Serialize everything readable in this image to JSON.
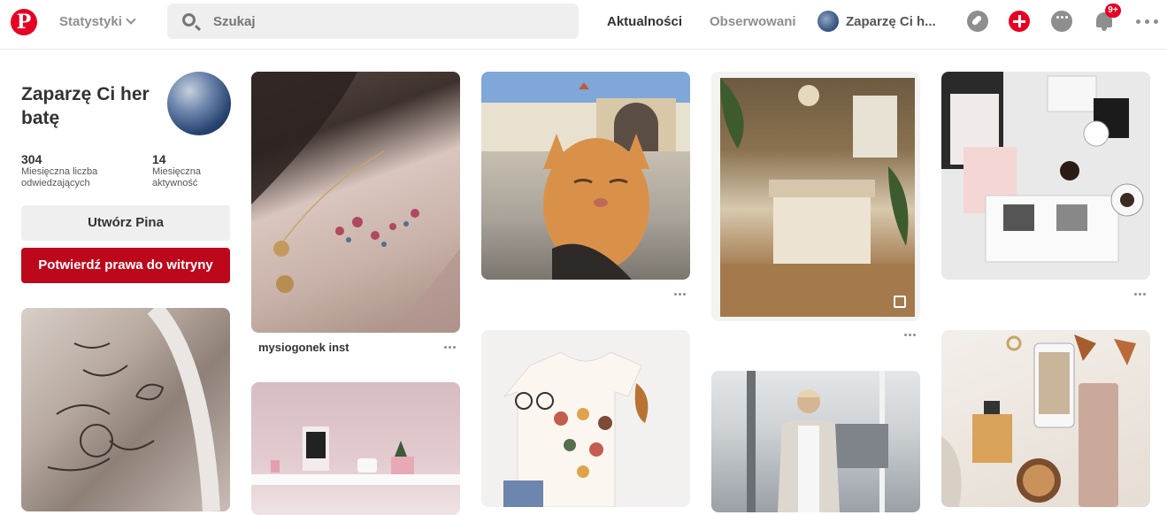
{
  "topbar": {
    "stats_label": "Statystyki",
    "search_placeholder": "Szukaj",
    "feed_label": "Aktualności",
    "following_label": "Obserwowani",
    "profile_label": "Zaparzę Ci h...",
    "notifications_badge": "9+",
    "brand_color": "#e60023"
  },
  "profile": {
    "name": "Zaparzę Ci her batę",
    "stats": [
      {
        "value": "304",
        "label": "Miesięczna liczba odwiedzających"
      },
      {
        "value": "14",
        "label": "Miesięczna aktywność"
      }
    ],
    "create_pin_button": "Utwórz Pina",
    "verify_site_button": "Potwierdź prawa do witryny"
  },
  "pins": {
    "col2_first_title": "mysiogonek inst"
  },
  "icons": [
    "pinterest-logo-icon",
    "chevron-down-icon",
    "search-icon",
    "compass-icon",
    "plus-icon",
    "chat-icon",
    "bell-icon",
    "more-icon",
    "expand-icon"
  ]
}
